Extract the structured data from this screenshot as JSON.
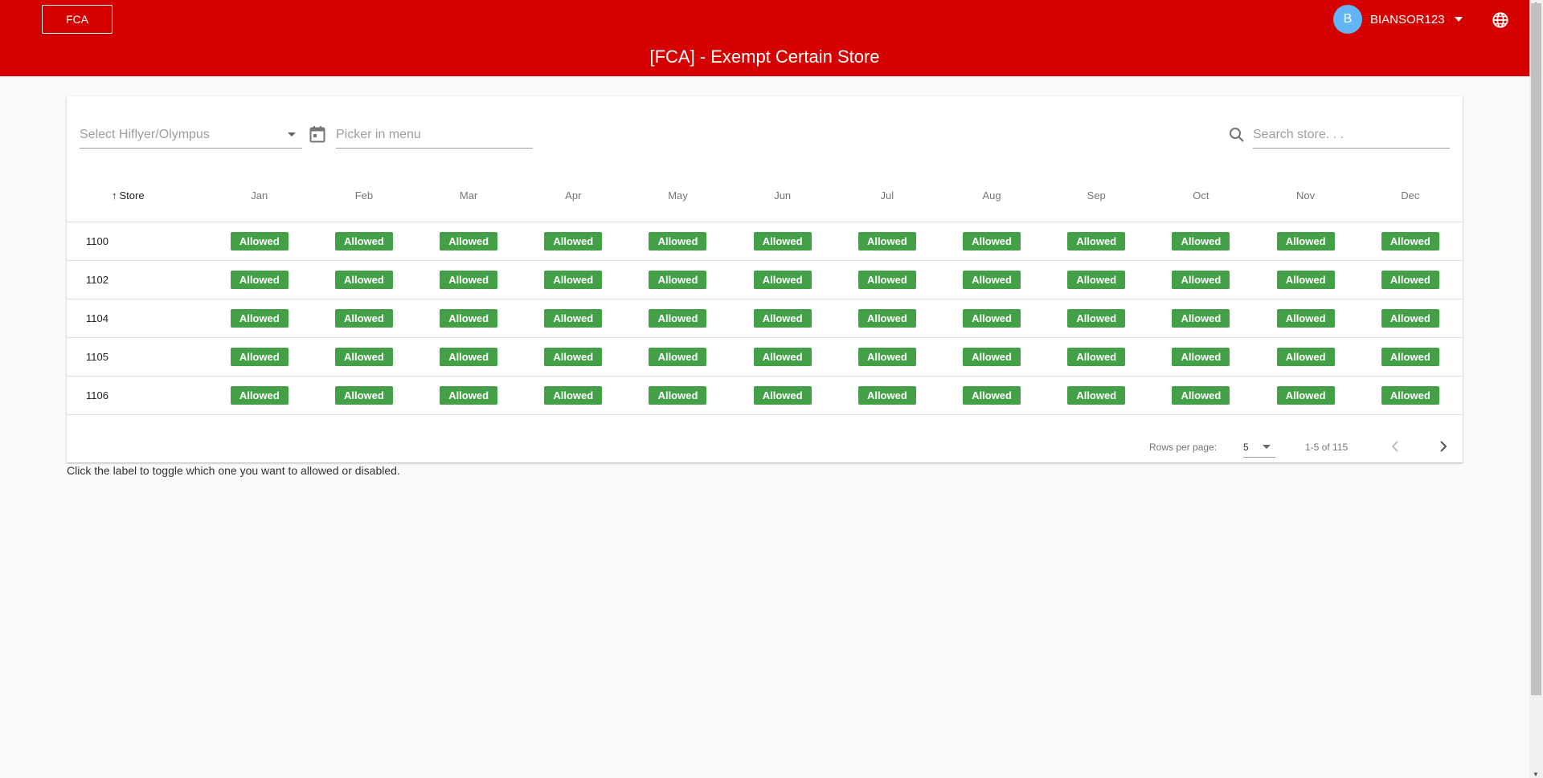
{
  "header": {
    "brand_label": "FCA",
    "title": "[FCA] - Exempt Certain Store",
    "user": {
      "initial": "B",
      "name": "BIANSOR123"
    }
  },
  "filters": {
    "select_placeholder": "Select Hiflyer/Olympus",
    "picker_placeholder": "Picker in menu",
    "search_placeholder": "Search store. . ."
  },
  "table": {
    "store_header": "Store",
    "months": [
      "Jan",
      "Feb",
      "Mar",
      "Apr",
      "May",
      "Jun",
      "Jul",
      "Aug",
      "Sep",
      "Oct",
      "Nov",
      "Dec"
    ],
    "rows": [
      {
        "store": "1100",
        "status": [
          "Allowed",
          "Allowed",
          "Allowed",
          "Allowed",
          "Allowed",
          "Allowed",
          "Allowed",
          "Allowed",
          "Allowed",
          "Allowed",
          "Allowed",
          "Allowed"
        ]
      },
      {
        "store": "1102",
        "status": [
          "Allowed",
          "Allowed",
          "Allowed",
          "Allowed",
          "Allowed",
          "Allowed",
          "Allowed",
          "Allowed",
          "Allowed",
          "Allowed",
          "Allowed",
          "Allowed"
        ]
      },
      {
        "store": "1104",
        "status": [
          "Allowed",
          "Allowed",
          "Allowed",
          "Allowed",
          "Allowed",
          "Allowed",
          "Allowed",
          "Allowed",
          "Allowed",
          "Allowed",
          "Allowed",
          "Allowed"
        ]
      },
      {
        "store": "1105",
        "status": [
          "Allowed",
          "Allowed",
          "Allowed",
          "Allowed",
          "Allowed",
          "Allowed",
          "Allowed",
          "Allowed",
          "Allowed",
          "Allowed",
          "Allowed",
          "Allowed"
        ]
      },
      {
        "store": "1106",
        "status": [
          "Allowed",
          "Allowed",
          "Allowed",
          "Allowed",
          "Allowed",
          "Allowed",
          "Allowed",
          "Allowed",
          "Allowed",
          "Allowed",
          "Allowed",
          "Allowed"
        ]
      }
    ]
  },
  "pagination": {
    "rows_label": "Rows per page:",
    "rows_value": "5",
    "range": "1-5 of 115"
  },
  "helper_text": "Click the label to toggle which one you want to allowed or disabled.",
  "colors": {
    "header": "#d50000",
    "allowed": "#43a047",
    "avatar": "#64b5f6"
  },
  "icons": [
    "globe-icon",
    "calendar-icon",
    "search-icon",
    "chevron-left-icon",
    "chevron-right-icon",
    "arrow-up-icon"
  ]
}
